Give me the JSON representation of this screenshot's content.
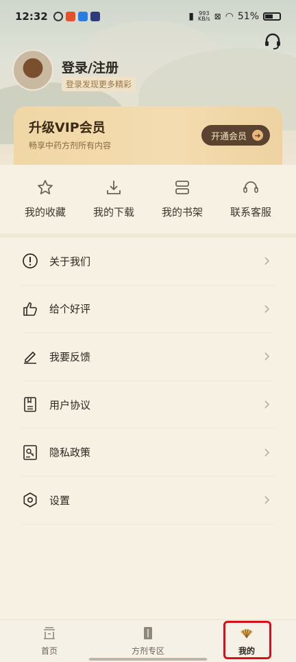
{
  "status_bar": {
    "time": "12:32",
    "net_speed_value": "993",
    "net_speed_unit": "KB/s",
    "battery": "51%"
  },
  "profile": {
    "title": "登录/注册",
    "subtitle": "登录发现更多精彩"
  },
  "vip": {
    "title": "升级VIP会员",
    "subtitle": "畅享中药方剂所有内容",
    "button": "开通会员"
  },
  "quick_actions": [
    {
      "label": "我的收藏",
      "icon": "star-icon"
    },
    {
      "label": "我的下载",
      "icon": "download-icon"
    },
    {
      "label": "我的书架",
      "icon": "bookshelf-icon"
    },
    {
      "label": "联系客服",
      "icon": "headset-icon"
    }
  ],
  "menu": [
    {
      "label": "关于我们",
      "icon": "info-icon"
    },
    {
      "label": "给个好评",
      "icon": "thumbs-up-icon"
    },
    {
      "label": "我要反馈",
      "icon": "pencil-icon"
    },
    {
      "label": "用户协议",
      "icon": "document-icon"
    },
    {
      "label": "隐私政策",
      "icon": "privacy-icon"
    },
    {
      "label": "设置",
      "icon": "settings-icon"
    }
  ],
  "tabs": [
    {
      "label": "首页",
      "icon": "home-icon",
      "active": false
    },
    {
      "label": "方剂专区",
      "icon": "formula-icon",
      "active": false
    },
    {
      "label": "我的",
      "icon": "fan-icon",
      "active": true
    }
  ],
  "colors": {
    "accent": "#5a4330",
    "vip_gold": "#f0d7a5",
    "highlight": "#d6101a",
    "background": "#f7f1e3"
  }
}
